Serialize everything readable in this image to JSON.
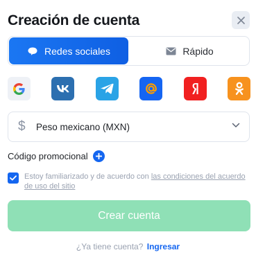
{
  "header": {
    "title": "Creación de cuenta",
    "close_icon": "close-icon"
  },
  "tabs": [
    {
      "label": "Redes sociales",
      "icon": "chat-bubble-icon",
      "active": true
    },
    {
      "label": "Rápido",
      "icon": "envelope-icon",
      "active": false
    }
  ],
  "socials": [
    {
      "name": "google",
      "icon": "google-icon",
      "color": "#eef1f6"
    },
    {
      "name": "vk",
      "icon": "vk-icon",
      "color": "#2c6fb0"
    },
    {
      "name": "telegram",
      "icon": "telegram-icon",
      "color": "#2aa3e6"
    },
    {
      "name": "mail",
      "icon": "mail-at-icon",
      "color": "#1565f2"
    },
    {
      "name": "yandex",
      "icon": "yandex-icon",
      "color": "#f12020"
    },
    {
      "name": "odnoklassniki",
      "icon": "odnoklassniki-icon",
      "color": "#f7921e"
    }
  ],
  "currency": {
    "symbol": "$",
    "label": "Peso mexicano (MXN)",
    "icon": "chevron-down-icon"
  },
  "promo": {
    "label": "Código promocional",
    "icon": "plus-icon"
  },
  "agreement": {
    "checked": true,
    "text": "Estoy familiarizado y de acuerdo con",
    "link": "las condiciones del acuerdo de uso del sitio"
  },
  "submit": {
    "label": "Crear cuenta",
    "color": "#8fe0b6"
  },
  "footer": {
    "question": "¿Ya tiene cuenta?",
    "login": "Ingresar"
  },
  "colors": {
    "accent": "#1466f0",
    "muted": "#9aa2b1"
  }
}
